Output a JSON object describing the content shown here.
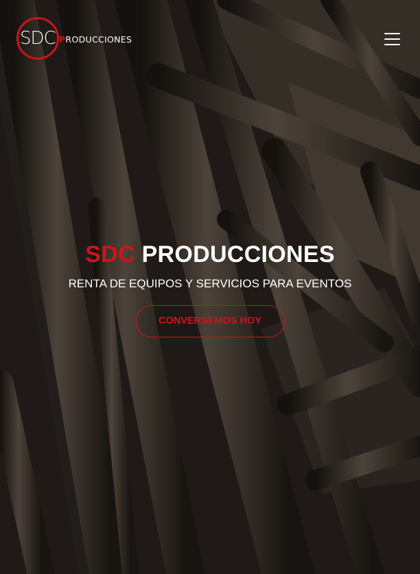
{
  "header": {
    "logo": {
      "mark_text": "SDC",
      "rest_first": "P",
      "rest_text": "RODUCCIONES"
    },
    "menu_icon": "hamburger-menu-icon"
  },
  "hero": {
    "title_accent": "SDC",
    "title_main": "PRODUCCIONES",
    "subtitle": "RENTA DE EQUIPOS Y SERVICIOS PARA EVENTOS",
    "cta_label": "CONVERSEMOS HOY",
    "background": "metal-truss-photo"
  },
  "colors": {
    "accent": "#d1121b",
    "text": "#ffffff",
    "background": "#2a241f"
  }
}
